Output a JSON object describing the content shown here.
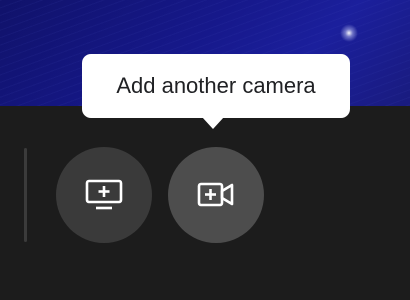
{
  "tooltip": {
    "text": "Add another camera"
  },
  "buttons": [
    {
      "id": "present",
      "icon": "add-screen-icon"
    },
    {
      "id": "camera",
      "icon": "add-camera-icon"
    }
  ],
  "colors": {
    "video_background": "#16188a",
    "controls_background": "#1c1c1c",
    "button_default": "#3a3a3a",
    "button_hover": "#4d4d4d",
    "tooltip_background": "#ffffff"
  }
}
